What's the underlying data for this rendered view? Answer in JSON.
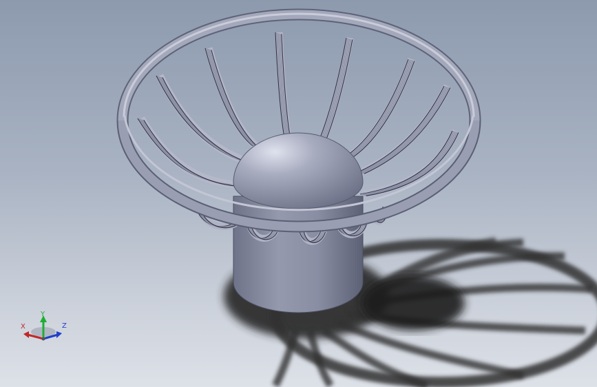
{
  "viewport": {
    "background_top": "#8d9aae",
    "background_bottom": "#dde1e8"
  },
  "model": {
    "body_color": "#8e93a8",
    "shadow_color": "#2a2a2a",
    "rib_count": 12
  },
  "triad": {
    "x_label": "X",
    "y_label": "Y",
    "z_label": "Z",
    "x_color": "#c0282a",
    "y_color": "#1fae35",
    "z_color": "#2040c8"
  }
}
